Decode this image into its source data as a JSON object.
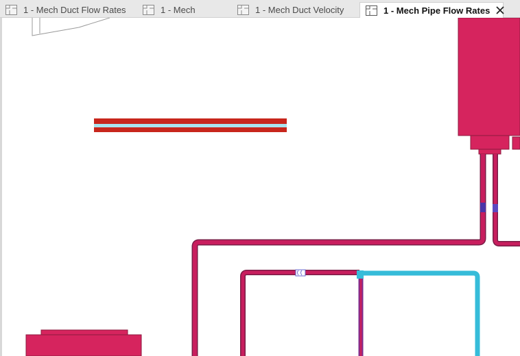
{
  "tabs": [
    {
      "label": "1 - Mech Duct Flow Rates",
      "active": false
    },
    {
      "label": "1 - Mech",
      "active": false
    },
    {
      "label": "1 - Mech Duct Velocity",
      "active": false
    },
    {
      "label": "1 - Mech Pipe Flow Rates",
      "active": true
    }
  ],
  "tab_icons": {
    "view": "floor-plan-view-icon",
    "close": "close-icon"
  },
  "colors": {
    "equipment": "#d6245e",
    "pipe_supply": "#c81e5e",
    "pipe_return": "#7d2d8f",
    "pipe_cyan": "#36bcd9",
    "duct_red": "#c8261c",
    "duct_cyan": "#a9e4ee",
    "tab_bar": "#e8e8e8"
  }
}
